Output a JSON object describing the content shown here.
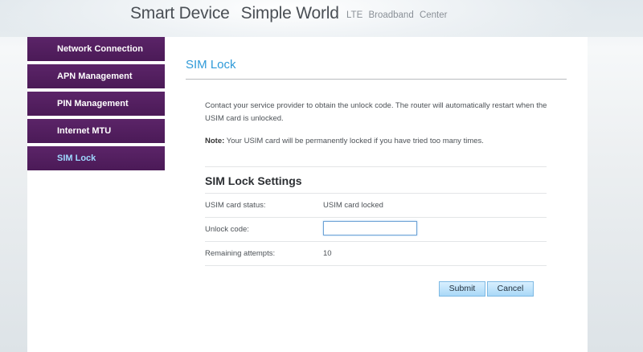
{
  "header": {
    "brand_part1": "Smart Device",
    "brand_part2": "Simple World",
    "sub_word1": "LTE",
    "sub_word2": "Broadband",
    "sub_word3": "Center"
  },
  "sidebar": {
    "items": [
      {
        "label": "Network Connection",
        "active": false
      },
      {
        "label": "APN Management",
        "active": false
      },
      {
        "label": "PIN Management",
        "active": false
      },
      {
        "label": "Internet MTU",
        "active": false
      },
      {
        "label": "SIM Lock",
        "active": true
      }
    ]
  },
  "main": {
    "title": "SIM Lock",
    "description": "Contact your service provider to obtain the unlock code. The router will automatically restart when the USIM card is unlocked.",
    "note_label": "Note:",
    "note_text": " Your USIM card will be permanently locked if you have tried too many times.",
    "settings": {
      "title": "SIM Lock Settings",
      "status_label": "USIM card status:",
      "status_value": "USIM card locked",
      "unlock_label": "Unlock code:",
      "unlock_value": "",
      "attempts_label": "Remaining attempts:",
      "attempts_value": "10"
    },
    "buttons": {
      "submit": "Submit",
      "cancel": "Cancel"
    }
  },
  "colors": {
    "accent": "#2f9ad8",
    "nav_bg": "#52205f",
    "nav_active_text": "#9fd8ff",
    "button_bg": "#a9d8f7"
  }
}
